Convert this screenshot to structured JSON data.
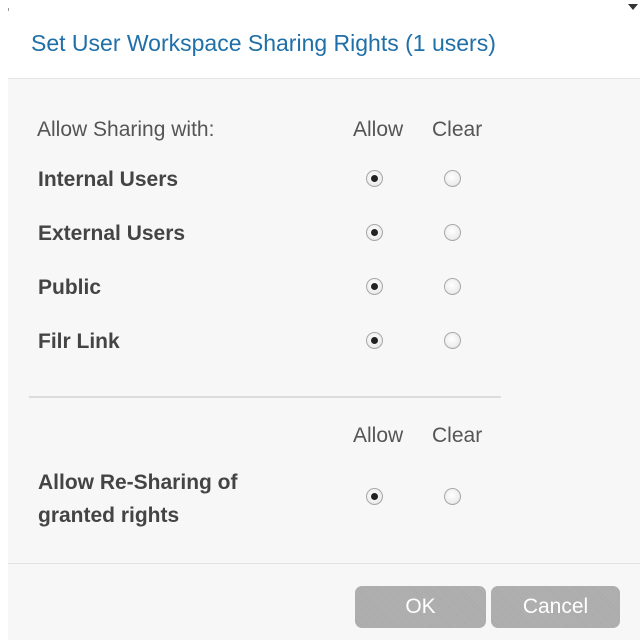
{
  "dialog": {
    "title": "Set User Workspace Sharing Rights (1 users)"
  },
  "sharing": {
    "header_label": "Allow Sharing with:",
    "allow_header": "Allow",
    "clear_header": "Clear",
    "rows": [
      {
        "label": "Internal Users",
        "selected": "allow"
      },
      {
        "label": "External Users",
        "selected": "allow"
      },
      {
        "label": "Public",
        "selected": "allow"
      },
      {
        "label": "Filr Link",
        "selected": "allow"
      }
    ]
  },
  "resharing": {
    "allow_header": "Allow",
    "clear_header": "Clear",
    "label_line1": "Allow Re-Sharing of",
    "label_line2": "granted rights",
    "selected": "allow"
  },
  "buttons": {
    "ok_label": "OK",
    "cancel_label": "Cancel"
  }
}
